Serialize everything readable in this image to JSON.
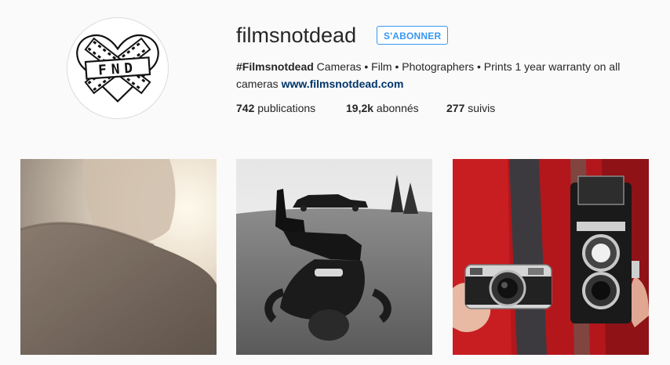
{
  "profile": {
    "username": "filmsnotdead",
    "follow_label": "S'ABONNER",
    "avatar_text": "FND",
    "bio": {
      "hashtag": "#Filmsnotdead",
      "text": " Cameras • Film • Photographers • Prints 1 year warranty on all cameras ",
      "link": "www.filmsnotdead.com"
    },
    "stats": [
      {
        "count": "742",
        "label": " publications"
      },
      {
        "count": "19,2k",
        "label": " abonnés"
      },
      {
        "count": "277",
        "label": " suivis"
      }
    ]
  },
  "posts": [
    {
      "subject": "sunlit-portrait-photo"
    },
    {
      "subject": "man-lying-on-grass-with-car-photo"
    },
    {
      "subject": "leica-and-rolleiflex-cameras-photo"
    }
  ],
  "colors": {
    "accent": "#3897f0",
    "link": "#003569",
    "background": "#fafafa",
    "text": "#262626"
  }
}
